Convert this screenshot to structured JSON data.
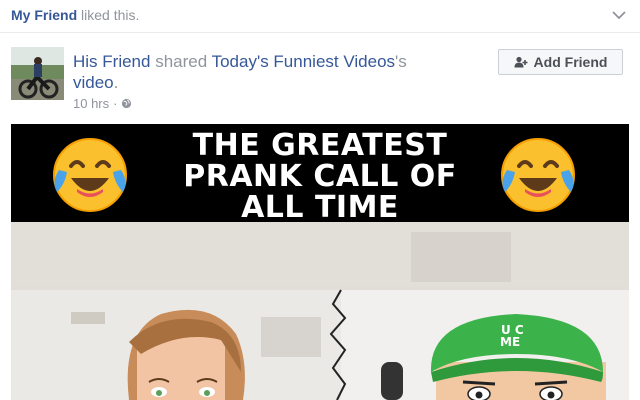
{
  "story_header": {
    "liker_name": "My Friend",
    "liked_text": " liked this."
  },
  "post": {
    "author_name": "His Friend",
    "shared_text": " shared ",
    "page_link": "Today's Funniest Videos",
    "possessive": "'s",
    "object_link": "video",
    "period": ".",
    "timestamp": "10 hrs",
    "separator": " · ",
    "add_friend_label": "Add Friend"
  },
  "video": {
    "title_lines": [
      "THE GREATEST",
      "PRANK CALL OF",
      "ALL TIME"
    ],
    "cap_text_line1": "U C",
    "cap_text_line2": "ME"
  },
  "icons": {
    "chevron": "chevron-down-icon",
    "globe": "globe-icon",
    "add_friend": "add-friend-icon",
    "emoji": "laughing-tears-emoji"
  },
  "colors": {
    "link": "#365899",
    "muted": "#90949c",
    "button_bg": "#f6f7f9"
  }
}
